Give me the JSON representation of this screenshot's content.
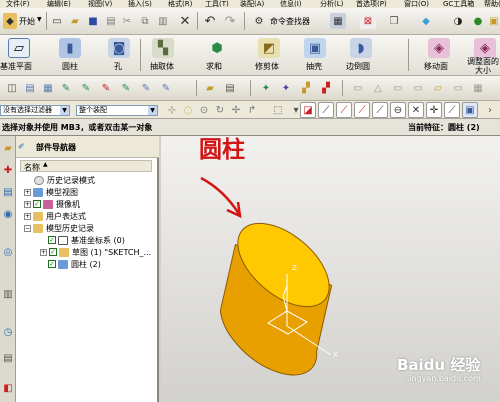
{
  "menubar": {
    "items": [
      "文件(F)",
      "编辑(E)",
      "视图(V)",
      "插入(S)",
      "格式(R)",
      "工具(T)",
      "装配(A)",
      "信息(I)",
      "分析(L)",
      "首选项(P)",
      "窗口(O)",
      "GC工具箱",
      "帮助(H)"
    ]
  },
  "toolbar1": {
    "start_label": "开始",
    "command_finder_label": "命令查找器"
  },
  "toolbar2": {
    "items": [
      {
        "label": "基准平面"
      },
      {
        "label": "圆柱"
      },
      {
        "label": "孔"
      },
      {
        "label": "抽取体"
      },
      {
        "label": "求和"
      },
      {
        "label": "修剪体"
      },
      {
        "label": "抽壳"
      },
      {
        "label": "边倒圆"
      },
      {
        "label": "移动面"
      },
      {
        "label": "调整面的大小"
      }
    ]
  },
  "selection": {
    "filter_value": "没有选择过滤器",
    "assembly_value": "整个装配"
  },
  "status": {
    "prompt": "选择对象并使用 MB3，或者双击某一对象",
    "current_feature": "当前特征：圆柱 (2)"
  },
  "navigator": {
    "title": "部件导航器",
    "column_name": "名称",
    "items": [
      {
        "label": "历史记录模式"
      },
      {
        "label": "模型视图"
      },
      {
        "label": "摄像机"
      },
      {
        "label": "用户表达式"
      },
      {
        "label": "模型历史记录"
      },
      {
        "label": "基准坐标系 (0)"
      },
      {
        "label": "草图 (1) \"SKETCH_..."
      },
      {
        "label": "圆柱 (2)"
      }
    ]
  },
  "viewport": {
    "annotation": "圆柱",
    "axis_x": "X",
    "axis_z": "Z"
  },
  "watermark": {
    "text": "Baidu 经验",
    "url": "jingyan.baidu.com"
  },
  "colors": {
    "cylinder_body": "#e8a000",
    "cylinder_top": "#ffc800",
    "annotation_red": "#d21414"
  }
}
